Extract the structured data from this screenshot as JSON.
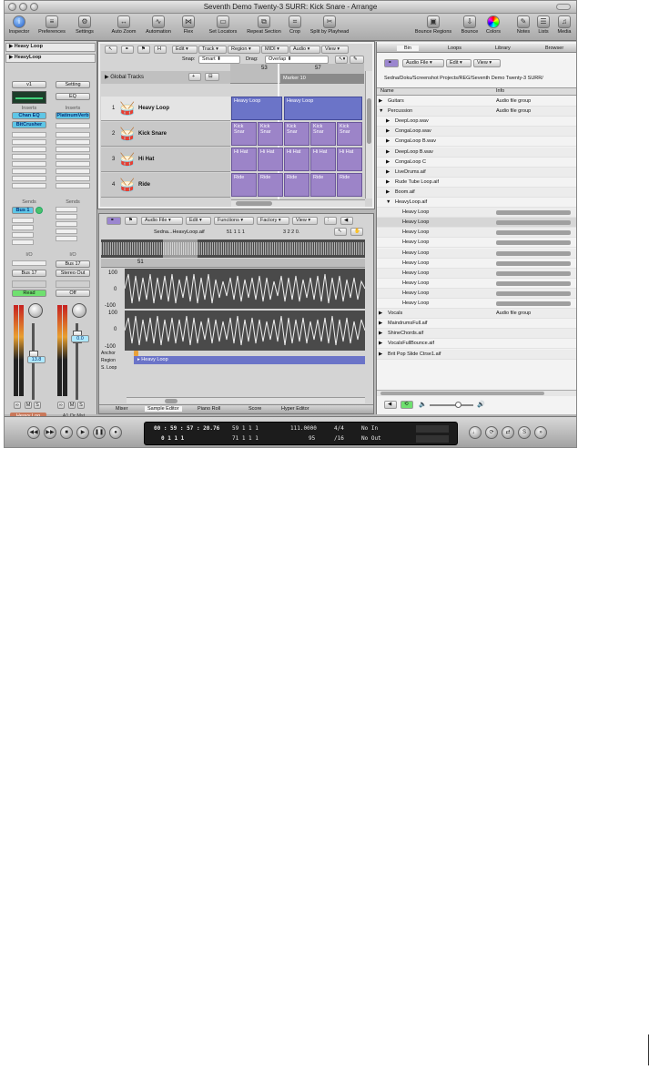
{
  "window": {
    "title": "Seventh Demo Twenty-3 SURR: Kick Snare - Arrange"
  },
  "toolbar": {
    "items": [
      {
        "label": "Inspector",
        "icon": "info-icon"
      },
      {
        "label": "Preferences",
        "icon": "preferences-icon"
      },
      {
        "label": "Settings",
        "icon": "settings-icon"
      },
      {
        "label": "Auto Zoom",
        "icon": "auto-zoom-icon"
      },
      {
        "label": "Automation",
        "icon": "automation-icon"
      },
      {
        "label": "Flex",
        "icon": "flex-icon"
      },
      {
        "label": "Set Locators",
        "icon": "set-locators-icon"
      },
      {
        "label": "Repeat Section",
        "icon": "repeat-section-icon"
      },
      {
        "label": "Crop",
        "icon": "crop-icon"
      },
      {
        "label": "Split by Playhead",
        "icon": "split-icon"
      },
      {
        "label": "Bounce Regions",
        "icon": "bounce-regions-icon"
      },
      {
        "label": "Bounce",
        "icon": "bounce-icon"
      },
      {
        "label": "Colors",
        "icon": "colors-icon"
      },
      {
        "label": "Notes",
        "icon": "notes-icon"
      },
      {
        "label": "Lists",
        "icon": "lists-icon"
      },
      {
        "label": "Media",
        "icon": "media-icon"
      }
    ]
  },
  "inspector": {
    "header1": "Heavy Loop",
    "header2": "HeavyLoop"
  },
  "strip1": {
    "setting": "v1",
    "inserts_label": "Inserts",
    "inserts": [
      "Chan EQ",
      "BitCrusher"
    ],
    "sends_label": "Sends",
    "send": "Bus 1",
    "io_label": "I/O",
    "input": "Bus 17",
    "automation": "Read",
    "volume": "13.8",
    "mute": "M",
    "solo": "S",
    "name": "Heavy Loo"
  },
  "strip2": {
    "setting": "Setting",
    "eq": "EQ",
    "inserts_label": "Inserts",
    "inserts": [
      "PlatinumVerb"
    ],
    "sends_label": "Sends",
    "io_label": "I/O",
    "input": "Bus 17",
    "output": "Stereo Out",
    "automation": "Off",
    "volume": "0.0",
    "mute": "M",
    "solo": "S",
    "name": "A1 Dr Mst"
  },
  "arrange": {
    "menus": [
      "Edit",
      "Track",
      "Region",
      "MIDI",
      "Audio",
      "View"
    ],
    "snap_label": "Snap:",
    "snap": "Smart",
    "drag_label": "Drag:",
    "drag": "Overlap",
    "global_tracks": "Global Tracks",
    "bar_marks": [
      "53",
      "57"
    ],
    "marker": "Marker 10",
    "tracks": [
      {
        "num": "1",
        "name": "Heavy Loop"
      },
      {
        "num": "2",
        "name": "Kick Snare"
      },
      {
        "num": "3",
        "name": "Hi Hat"
      },
      {
        "num": "4",
        "name": "Ride"
      }
    ],
    "regions": [
      [
        "Heavy Loop",
        "Heavy Loop"
      ],
      [
        "Kick Snar",
        "Kick Snar",
        "Kick Snar",
        "Kick Snar",
        "Kick Snar"
      ],
      [
        "Hi Hat",
        "Hi Hat",
        "Hi Hat",
        "Hi Hat",
        "Hi Hat"
      ],
      [
        "Ride",
        "Ride",
        "Ride",
        "Ride",
        "Ride"
      ]
    ]
  },
  "sample_editor": {
    "menus": [
      "Audio File",
      "Edit",
      "Functions",
      "Factory",
      "View"
    ],
    "file": "Sedna...HeavyLoop.aif",
    "pos": "51  1  1  1",
    "len": "3  2  2  0.",
    "bar": "51",
    "y_top": "100",
    "y_zero": "0",
    "y_bot": "-100",
    "anchor_label": "Anchor",
    "region_label": "Region",
    "sloop_label": "S. Loop",
    "region_name": "Heavy Loop",
    "tabs": [
      "Mixer",
      "Sample Editor",
      "Piano Roll",
      "Score",
      "Hyper Editor"
    ]
  },
  "bin": {
    "tabs": [
      "Bin",
      "Loops",
      "Library",
      "Browser"
    ],
    "menus": [
      "Audio File",
      "Edit",
      "View"
    ],
    "path": "Sedna/Doku/Screenshot Projects/REG/Seventh Demo Twenty-3 SURR/",
    "col_name": "Name",
    "col_info": "Info",
    "rows": [
      {
        "name": "Guitars",
        "indent": 0,
        "arrow": "▶",
        "info": "Audio file group",
        "bar": false
      },
      {
        "name": "Percussion",
        "indent": 0,
        "arrow": "▼",
        "info": "Audio file group",
        "bar": false
      },
      {
        "name": "DeepLoop.wav",
        "indent": 1,
        "arrow": "▶",
        "info": "",
        "bar": false
      },
      {
        "name": "CongaLoop.wav",
        "indent": 1,
        "arrow": "▶",
        "info": "",
        "bar": false
      },
      {
        "name": "CongaLoop B.wav",
        "indent": 1,
        "arrow": "▶",
        "info": "",
        "bar": false
      },
      {
        "name": "DeepLoop B.wav",
        "indent": 1,
        "arrow": "▶",
        "info": "",
        "bar": false
      },
      {
        "name": "CongaLoop C",
        "indent": 1,
        "arrow": "▶",
        "info": "",
        "bar": false
      },
      {
        "name": "LiveDrums.aif",
        "indent": 1,
        "arrow": "▶",
        "info": "",
        "bar": false
      },
      {
        "name": "Rude Tube Loop.aif",
        "indent": 1,
        "arrow": "▶",
        "info": "",
        "bar": false
      },
      {
        "name": "Boom.aif",
        "indent": 1,
        "arrow": "▶",
        "info": "",
        "bar": false
      },
      {
        "name": "HeavyLoop.aif",
        "indent": 1,
        "arrow": "▼",
        "info": "",
        "bar": false
      },
      {
        "name": "Heavy Loop",
        "indent": 2,
        "arrow": "",
        "info": "",
        "bar": true
      },
      {
        "name": "Heavy Loop",
        "indent": 2,
        "arrow": "",
        "info": "",
        "bar": true
      },
      {
        "name": "Heavy Loop",
        "indent": 2,
        "arrow": "",
        "info": "",
        "bar": true
      },
      {
        "name": "Heavy Loop",
        "indent": 2,
        "arrow": "",
        "info": "",
        "bar": true
      },
      {
        "name": "Heavy Loop",
        "indent": 2,
        "arrow": "",
        "info": "",
        "bar": true
      },
      {
        "name": "Heavy Loop",
        "indent": 2,
        "arrow": "",
        "info": "",
        "bar": true
      },
      {
        "name": "Heavy Loop",
        "indent": 2,
        "arrow": "",
        "info": "",
        "bar": true
      },
      {
        "name": "Heavy Loop",
        "indent": 2,
        "arrow": "",
        "info": "",
        "bar": true
      },
      {
        "name": "Heavy Loop",
        "indent": 2,
        "arrow": "",
        "info": "",
        "bar": true
      },
      {
        "name": "Heavy Loop",
        "indent": 2,
        "arrow": "",
        "info": "",
        "bar": true
      },
      {
        "name": "Vocals",
        "indent": 0,
        "arrow": "▶",
        "info": "Audio file group",
        "bar": false
      },
      {
        "name": "MaindrumsFull.aif",
        "indent": 0,
        "arrow": "▶",
        "info": "",
        "bar": false
      },
      {
        "name": "ShineChords.aif",
        "indent": 0,
        "arrow": "▶",
        "info": "",
        "bar": false
      },
      {
        "name": "VocalsFullBounce.aif",
        "indent": 0,
        "arrow": "▶",
        "info": "",
        "bar": false
      },
      {
        "name": "Brit Pop Slide Ctrse1.aif",
        "indent": 0,
        "arrow": "▶",
        "info": "",
        "bar": false
      }
    ]
  },
  "transport": {
    "time": "00 : 59 : 57 : 20.76",
    "bars": "0   1   1   1",
    "pos_top": "59   1   1   1",
    "pos_bot": "71   1   1   1",
    "tempo": "111.0000",
    "tempo_bot": "95",
    "sig": "4/4",
    "div": "/16",
    "in": "No In",
    "out": "No Out"
  }
}
